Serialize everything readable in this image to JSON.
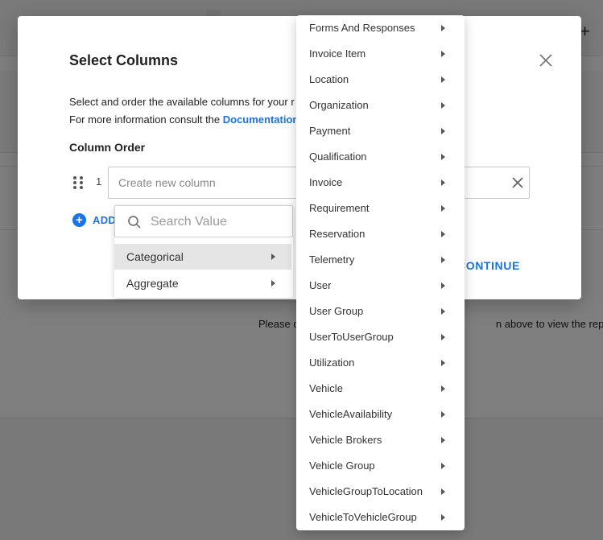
{
  "background": {
    "message_left": "Please c",
    "message_right": "n above to view the report"
  },
  "modal": {
    "title": "Select Columns",
    "description_line1": "Select and order the available columns for your r",
    "description_line2_prefix": "For more information consult the ",
    "documentation_link": "Documentation",
    "column_order_label": "Column Order",
    "rows": [
      {
        "index": "1",
        "placeholder": "Create new column",
        "value": ""
      }
    ],
    "add_label": "ADD",
    "continue_label": "CONTINUE"
  },
  "category_dropdown": {
    "search_placeholder": "Search Value",
    "items": [
      {
        "label": "Categorical",
        "active": true
      },
      {
        "label": "Aggregate",
        "active": false
      }
    ]
  },
  "tables_menu": {
    "items": [
      "Forms And Responses",
      "Invoice Item",
      "Location",
      "Organization",
      "Payment",
      "Qualification",
      "Invoice",
      "Requirement",
      "Reservation",
      "Telemetry",
      "User",
      "User Group",
      "UserToUserGroup",
      "Utilization",
      "Vehicle",
      "VehicleAvailability",
      "Vehicle Brokers",
      "Vehicle Group",
      "VehicleGroupToLocation",
      "VehicleToVehicleGroup"
    ]
  },
  "colors": {
    "accent": "#1a73e8",
    "overlay": "rgba(0,0,0,0.5)",
    "active_item_bg": "#e5e5e5"
  },
  "icons": [
    "close-icon",
    "drag-handle-icon",
    "clear-icon",
    "add-circle-icon",
    "search-icon",
    "chevron-right-icon"
  ]
}
